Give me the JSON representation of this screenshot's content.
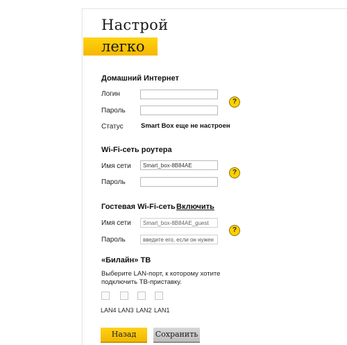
{
  "logo": {
    "line1": "Настрой",
    "line2": "легко"
  },
  "home_internet": {
    "title": "Домашний Интернет",
    "login_label": "Логин",
    "password_label": "Пароль",
    "status_label": "Статус",
    "status_value": "Smart Box еще не настроен"
  },
  "router_wifi": {
    "title": "Wi-Fi-сеть роутера",
    "ssid_label": "Имя сети",
    "ssid_value": "Smart_box-8B84AE",
    "password_label": "Пароль"
  },
  "guest_wifi": {
    "title": "Гостевая Wi-Fi-сеть",
    "enable_link": "Включить",
    "ssid_label": "Имя сети",
    "ssid_value": "Smart_box-8B84AE_guest",
    "password_label": "Пароль",
    "password_placeholder": "введите его, если он нужен"
  },
  "tv": {
    "title": "«Билайн» ТВ",
    "description": "Выберите LAN-порт, к которому хотите подключить ТВ-приставку.",
    "ports": [
      "LAN4",
      "LAN3",
      "LAN2",
      "LAN1"
    ]
  },
  "help_glyph": "?",
  "buttons": {
    "back": "Назад",
    "save": "Сохранить"
  },
  "colors": {
    "brand_yellow": "#ffd000",
    "save_gray": "#c8c8c8"
  }
}
